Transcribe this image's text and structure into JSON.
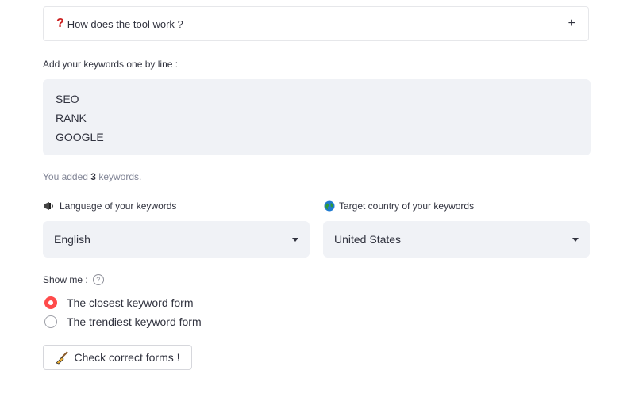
{
  "expander": {
    "icon": "question-mark-icon",
    "label": "How does the tool work ?",
    "toggle": "+"
  },
  "keywords": {
    "label": "Add your keywords one by line :",
    "value": "SEO\nRANK\nGOOGLE",
    "count_prefix": "You added ",
    "count": "3",
    "count_suffix": " keywords."
  },
  "language": {
    "icon": "megaphone-icon",
    "label": "Language of your keywords",
    "selected": "English"
  },
  "country": {
    "icon": "globe-icon",
    "label": "Target country of your keywords",
    "selected": "United States"
  },
  "show_me": {
    "label": "Show me :",
    "help_icon": "help-icon",
    "options": [
      {
        "label": "The closest keyword form",
        "selected": true
      },
      {
        "label": "The trendiest keyword form",
        "selected": false
      }
    ]
  },
  "button": {
    "icon": "broom-icon",
    "label": "Check correct forms !"
  },
  "colors": {
    "accent": "#ff4b4b",
    "field_bg": "#f0f2f6",
    "text": "#31333f",
    "muted": "#808495"
  }
}
